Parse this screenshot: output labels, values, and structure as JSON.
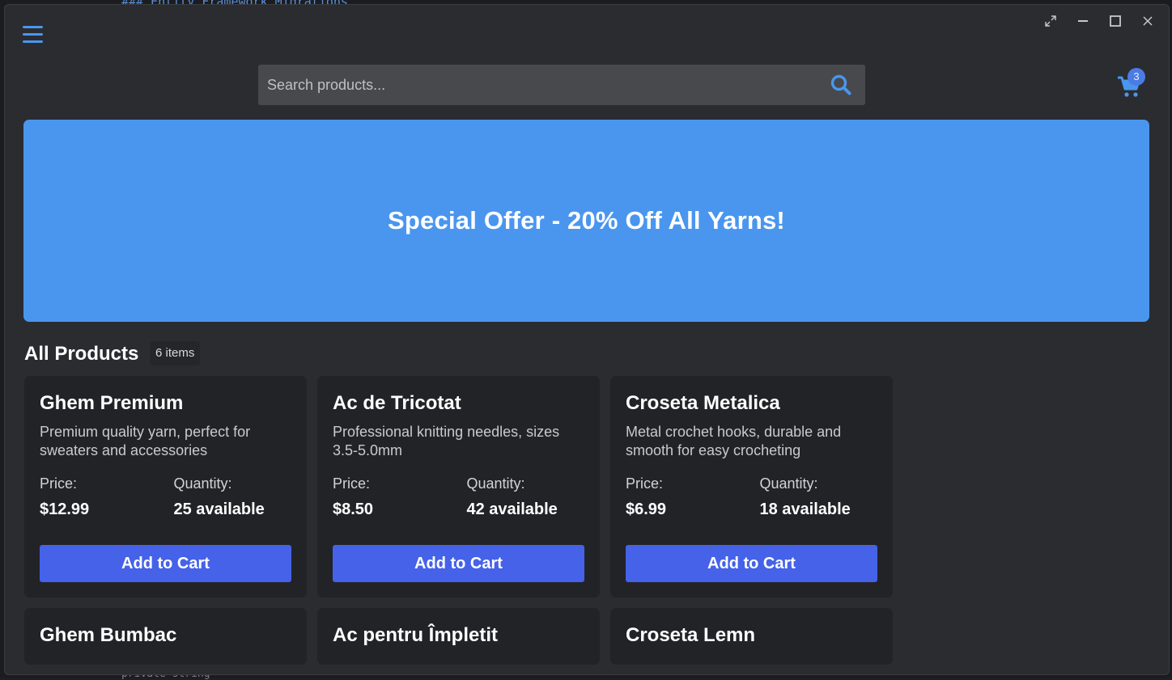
{
  "background": {
    "editor_top_text": "### Entity Framework Migrations",
    "editor_bottom_text": "private string"
  },
  "window": {
    "controls": [
      {
        "name": "expand-icon",
        "glyph": "⤢"
      },
      {
        "name": "minimize-icon",
        "glyph": "—"
      },
      {
        "name": "maximize-icon",
        "glyph": "☐"
      },
      {
        "name": "close-icon",
        "glyph": "✕"
      }
    ]
  },
  "header": {
    "menu_icon": "hamburger-menu-icon",
    "search": {
      "placeholder": "Search products...",
      "value": "",
      "icon": "search-icon"
    },
    "cart": {
      "icon": "shopping-cart-icon",
      "count": "3"
    }
  },
  "banner": {
    "text": "Special Offer - 20% Off All Yarns!",
    "color": "#4a96ef"
  },
  "products_section": {
    "title": "All Products",
    "count_label": "6 items",
    "price_label": "Price:",
    "quantity_label": "Quantity:",
    "add_button_label": "Add to Cart",
    "products": [
      {
        "name": "Ghem Premium",
        "description": "Premium quality yarn, perfect for sweaters and accessories",
        "price": "$12.99",
        "quantity": "25 available"
      },
      {
        "name": "Ac de Tricotat",
        "description": "Professional knitting needles, sizes 3.5-5.0mm",
        "price": "$8.50",
        "quantity": "42 available"
      },
      {
        "name": "Croseta Metalica",
        "description": "Metal crochet hooks, durable and smooth for easy crocheting",
        "price": "$6.99",
        "quantity": "18 available"
      },
      {
        "name": "Ghem Bumbac"
      },
      {
        "name": "Ac pentru Împletit"
      },
      {
        "name": "Croseta Lemn"
      }
    ]
  },
  "colors": {
    "accent": "#4a96ee",
    "button": "#4562e8",
    "card_bg": "#222327",
    "window_bg": "#2b2c30"
  }
}
